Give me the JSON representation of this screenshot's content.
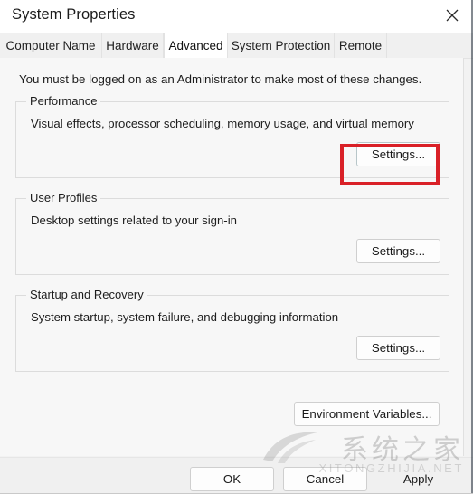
{
  "window": {
    "title": "System Properties",
    "close_icon": "close-icon"
  },
  "tabs": [
    {
      "label": "Computer Name",
      "selected": false
    },
    {
      "label": "Hardware",
      "selected": false
    },
    {
      "label": "Advanced",
      "selected": true
    },
    {
      "label": "System Protection",
      "selected": false
    },
    {
      "label": "Remote",
      "selected": false
    }
  ],
  "content": {
    "admin_note": "You must be logged on as an Administrator to make most of these changes.",
    "groups": [
      {
        "legend": "Performance",
        "description": "Visual effects, processor scheduling, memory usage, and virtual memory",
        "button": "Settings..."
      },
      {
        "legend": "User Profiles",
        "description": "Desktop settings related to your sign-in",
        "button": "Settings..."
      },
      {
        "legend": "Startup and Recovery",
        "description": "System startup, system failure, and debugging information",
        "button": "Settings..."
      }
    ],
    "environment_variables_button": "Environment Variables..."
  },
  "footer": {
    "ok": "OK",
    "cancel": "Cancel",
    "apply": "Apply"
  },
  "highlight": {
    "color": "#d92027",
    "target": "Settings... (Performance)"
  },
  "watermark": {
    "chinese": "系统之家",
    "english": "XITONGZHIJIA.NET"
  }
}
